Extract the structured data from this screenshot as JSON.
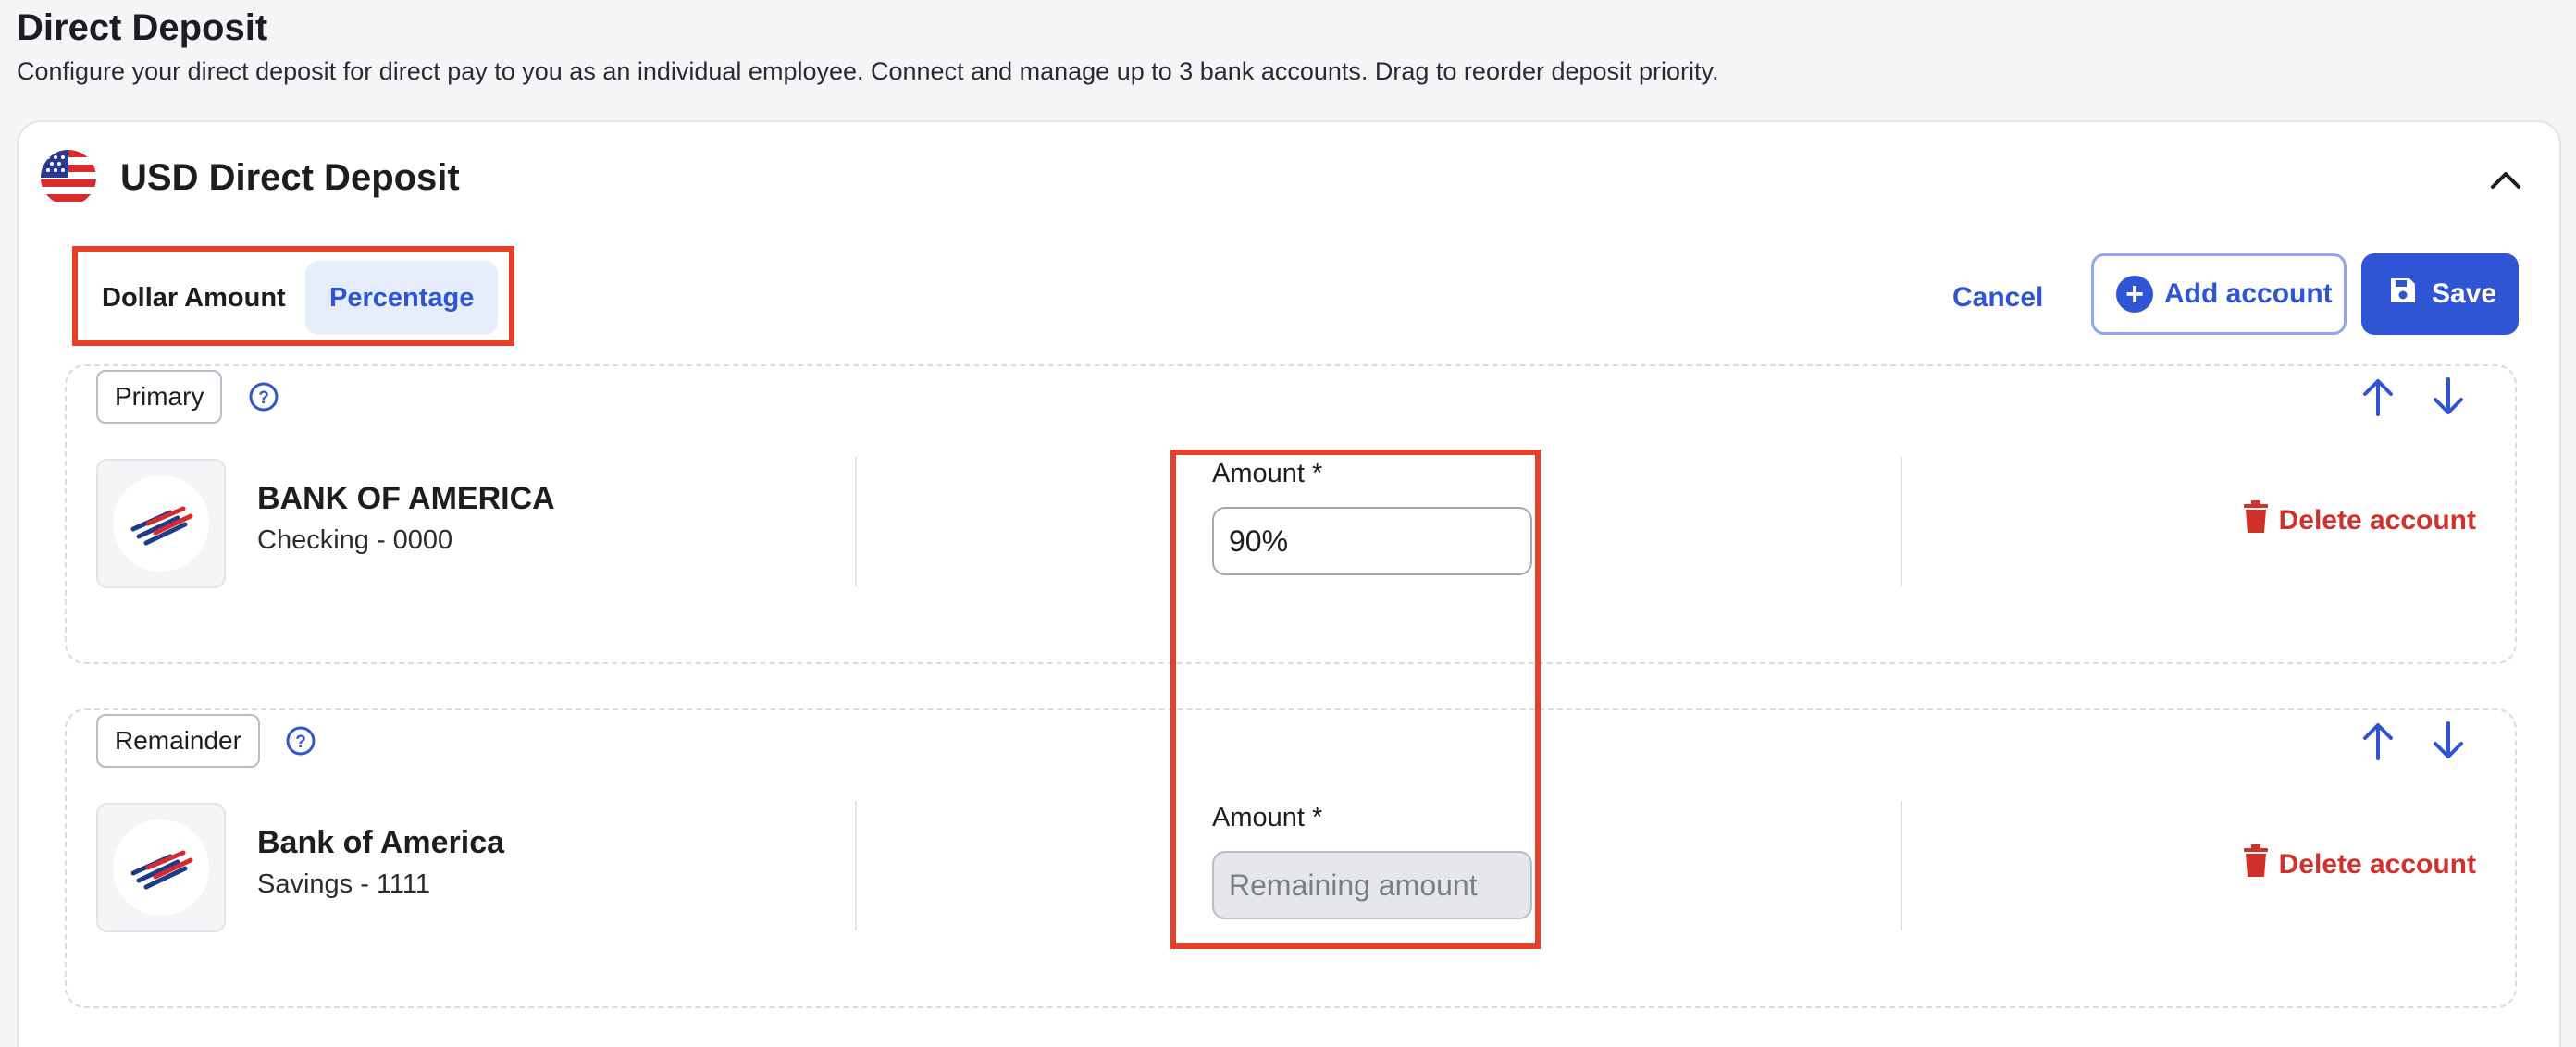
{
  "page": {
    "title": "Direct Deposit",
    "description": "Configure your direct deposit for direct pay to you as an individual employee. Connect and manage up to 3 bank accounts. Drag to reorder deposit priority."
  },
  "card": {
    "title": "USD Direct Deposit",
    "flag_icon": "us-flag-icon",
    "collapse_icon": "chevron-up-icon"
  },
  "toggle": {
    "dollar_label": "Dollar Amount",
    "percentage_label": "Percentage",
    "selected": "Percentage"
  },
  "actions": {
    "cancel_label": "Cancel",
    "add_label": "Add account",
    "save_label": "Save"
  },
  "accounts": [
    {
      "tag": "Primary",
      "bank_name": "BANK OF AMERICA",
      "account": "Checking - 0000",
      "amount_label": "Amount *",
      "amount_value": "90%",
      "amount_placeholder": "",
      "delete_label": "Delete account"
    },
    {
      "tag": "Remainder",
      "bank_name": "Bank of America",
      "account": "Savings - 1111",
      "amount_label": "Amount *",
      "amount_value": "",
      "amount_placeholder": "Remaining amount",
      "delete_label": "Delete account"
    }
  ],
  "colors": {
    "accent": "#2f55d4",
    "danger": "#d0312a",
    "highlight": "#e5402a"
  }
}
